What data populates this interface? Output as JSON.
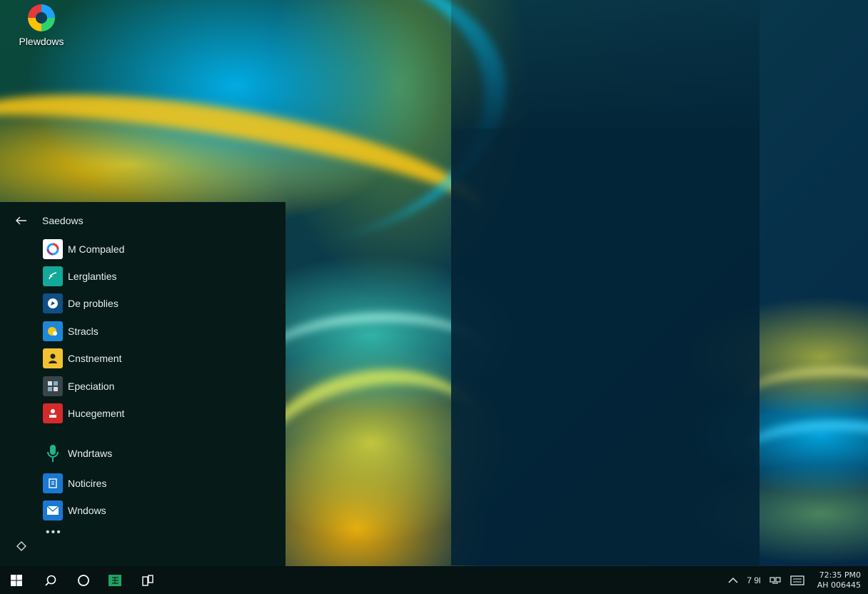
{
  "desktop": {
    "icon_label": "Plewdows"
  },
  "start_menu": {
    "title": "Saedows",
    "apps": [
      {
        "label": "M Compaled",
        "icon": "browser-icon",
        "color": "#ffffff"
      },
      {
        "label": "Lerglanties",
        "icon": "teal-app-icon",
        "color": "#12a89a"
      },
      {
        "label": "De problies",
        "icon": "navigation-icon",
        "color": "#0f4f86"
      },
      {
        "label": "Stracls",
        "icon": "maps-icon",
        "color": "#1e88d8"
      },
      {
        "label": "Cnstnement",
        "icon": "person-icon",
        "color": "#f2c230"
      },
      {
        "label": "Epeciation",
        "icon": "grid-app-icon",
        "color": "#3b4448"
      },
      {
        "label": "Hucegement",
        "icon": "user-alert-icon",
        "color": "#d62a2a"
      },
      {
        "label": "Wndrtaws",
        "icon": "microphone-icon",
        "color": "#1fb38a"
      },
      {
        "label": "Noticires",
        "icon": "notes-icon",
        "color": "#1a78d2"
      },
      {
        "label": "Wndows",
        "icon": "mail-icon",
        "color": "#1a78d2"
      }
    ],
    "more": "•••"
  },
  "taskbar": {
    "buttons": [
      "start-icon",
      "search-icon",
      "cortana-icon",
      "spreadsheet-icon",
      "phone-link-icon"
    ],
    "tray_text": "7 9l",
    "time": "72:35 PM0",
    "date": "AH 006445"
  },
  "colors": {
    "menu_bg": "#061a18",
    "taskbar_bg": "#071212",
    "accent": "#1a78d2"
  }
}
